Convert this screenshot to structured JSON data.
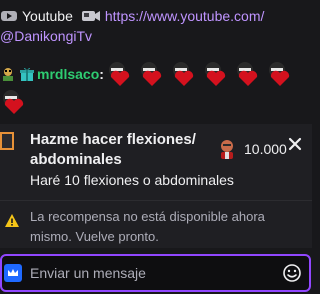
{
  "chat": {
    "message1": {
      "prefix_text": "Youtube",
      "link": "https://www.youtube.com/",
      "handle": "@DanikongiTv"
    },
    "message2": {
      "username": "mrdlsaco",
      "colon": ":"
    }
  },
  "reward": {
    "title": "Hazme hacer flexiones/ abdominales",
    "description": "Haré 10 flexiones o abdominales",
    "cost": "10.000",
    "close_icon": "close-icon"
  },
  "warning": {
    "text": "La recompensa no está disponible ahora mismo. Vuelve pronto."
  },
  "composer": {
    "placeholder": "Enviar un mensaje"
  },
  "colors": {
    "accent": "#9147ff",
    "link": "#bf94ff",
    "username": "#2ecc71",
    "background": "#18181b"
  }
}
